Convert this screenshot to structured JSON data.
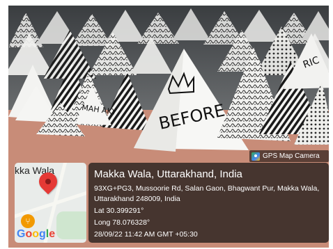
{
  "photo": {
    "crown_word": "BEFORE",
    "small_pyramid_text": "MAH AKY",
    "right_pyramid_text": "RIC"
  },
  "badge": {
    "label": "GPS Map Camera",
    "icon": "gps-camera-icon"
  },
  "map": {
    "place_label": "kka Wala",
    "pin_icon": "location-pin-icon",
    "poi_icon": "restaurant-fork-icon",
    "logo": "Google",
    "pin_color": "#e53935"
  },
  "info": {
    "title": "Makka Wala, Uttarakhand, India",
    "address": "93XG+PG3, Mussoorie Rd, Salan Gaon, Bhagwant Pur, Makka Wala, Uttarakhand 248009, India",
    "lat": "Lat 30.399291°",
    "long": "Long 78.076328°",
    "timestamp": "28/09/22 11:42 AM GMT +05:30"
  }
}
